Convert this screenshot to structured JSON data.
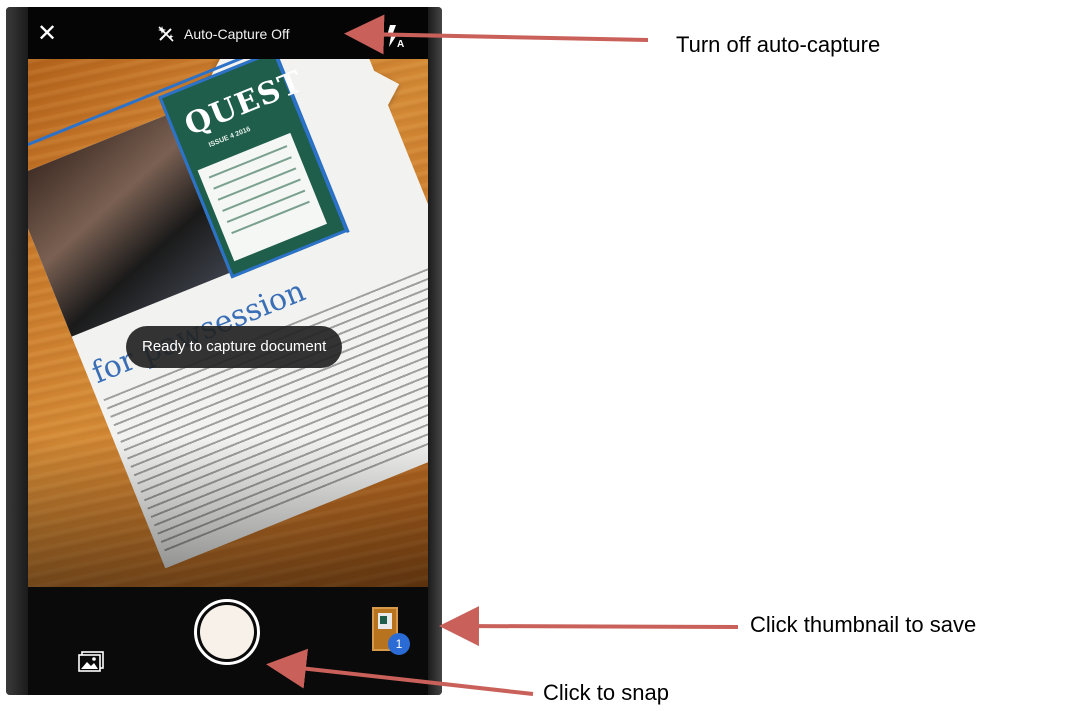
{
  "phone": {
    "topbar": {
      "close_label": "✕",
      "auto_capture_label": "Auto-Capture Off",
      "auto_capture_icon": "magic-wand-off-icon",
      "flash_icon": "flash-auto-icon"
    },
    "viewfinder": {
      "status_message": "Ready to capture document",
      "document": {
        "masthead": "QUEST",
        "issue": "ISSUE 4 2016",
        "headline": "for pawsession"
      }
    },
    "bottombar": {
      "gallery_icon": "image-gallery-icon",
      "shutter_icon": "shutter-button",
      "thumbnail_count": "1"
    }
  },
  "annotations": [
    {
      "text": "Turn off auto-capture"
    },
    {
      "text": "Click thumbnail to save"
    },
    {
      "text": "Click to snap"
    }
  ],
  "colors": {
    "arrow": "#c9605a",
    "badge": "#2a6bd6",
    "document_frame": "#2c72c9",
    "quest_cover": "#1f5e4b"
  }
}
